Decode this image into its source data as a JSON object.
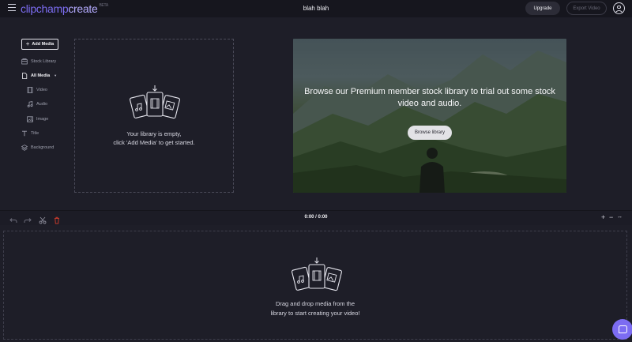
{
  "app": {
    "logo_part1": "clipchamp",
    "logo_part2": "create",
    "logo_badge": "BETA",
    "project_title": "blah blah"
  },
  "header": {
    "upgrade_label": "Upgrade",
    "export_label": "Export Video"
  },
  "sidebar": {
    "add_media_label": "Add Media",
    "items": [
      {
        "label": "Stock Library",
        "icon": "stock-library-icon"
      },
      {
        "label": "All Media",
        "icon": "document-icon"
      },
      {
        "label": "Video",
        "icon": "film-icon"
      },
      {
        "label": "Audio",
        "icon": "music-note-icon"
      },
      {
        "label": "Image",
        "icon": "image-icon"
      },
      {
        "label": "Title",
        "icon": "title-icon"
      },
      {
        "label": "Background",
        "icon": "layers-icon"
      }
    ]
  },
  "library": {
    "empty_line1": "Your library is empty,",
    "empty_line2": "click 'Add Media' to get started."
  },
  "promo": {
    "text_line1": "Browse our Premium member stock library to trial out some stock",
    "text_line2": "video and audio.",
    "button_label": "Browse library"
  },
  "timeline": {
    "timecode": "0:00 / 0:00",
    "drop_line1": "Drag and drop media from the",
    "drop_line2": "library to start creating your video!"
  },
  "colors": {
    "accent": "#7c6cf2",
    "delete": "#c0392b",
    "background": "#1e1e28"
  }
}
